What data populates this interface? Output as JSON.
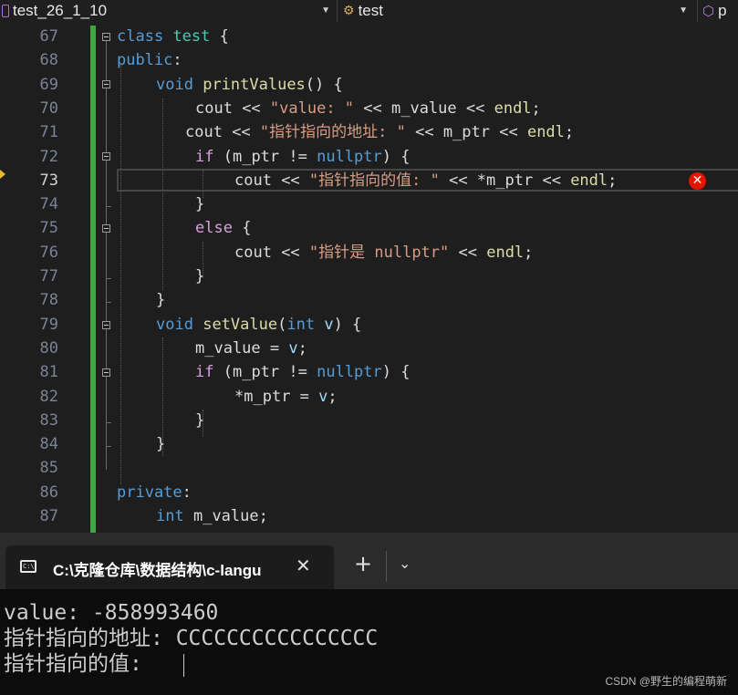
{
  "navbar": {
    "project": "test_26_1_10",
    "scope": "test",
    "member": "p"
  },
  "editor": {
    "line_numbers": [
      "67",
      "68",
      "69",
      "70",
      "71",
      "72",
      "73",
      "74",
      "75",
      "76",
      "77",
      "78",
      "79",
      "80",
      "81",
      "82",
      "83",
      "84",
      "85",
      "86",
      "87"
    ],
    "current_line": "73",
    "code": {
      "l67": {
        "a": "class",
        "b": "test",
        "c": " {"
      },
      "l68": {
        "a": "public",
        "b": ":"
      },
      "l69": {
        "a": "void",
        "b": "printValues",
        "c": "() {"
      },
      "l70": {
        "a": "cout",
        "b": " << ",
        "c": "\"value: \"",
        "d": " << ",
        "e": "m_value",
        "f": " << ",
        "g": "endl",
        "h": ";"
      },
      "l71": {
        "a": "cout",
        "b": " << ",
        "c": "\"指针指向的地址: \"",
        "d": " << ",
        "e": "m_ptr",
        "f": " << ",
        "g": "endl",
        "h": ";"
      },
      "l72": {
        "a": "if",
        "b": " (",
        "c": "m_ptr",
        "d": " != ",
        "e": "nullptr",
        "f": ") {"
      },
      "l73": {
        "a": "cout",
        "b": " << ",
        "c": "\"指针指向的值: \"",
        "d": " << *",
        "e": "m_ptr",
        "f": " << ",
        "g": "endl",
        "h": ";"
      },
      "l74": {
        "a": "}"
      },
      "l75": {
        "a": "else",
        "b": " {"
      },
      "l76": {
        "a": "cout",
        "b": " << ",
        "c": "\"指针是 nullptr\"",
        "d": " << ",
        "e": "endl",
        "f": ";"
      },
      "l77": {
        "a": "}"
      },
      "l78": {
        "a": "}"
      },
      "l79": {
        "a": "void",
        "b": "setValue",
        "c": "(",
        "d": "int",
        "e": " ",
        "f": "v",
        "g": ") {"
      },
      "l80": {
        "a": "m_value",
        "b": " = ",
        "c": "v",
        "d": ";"
      },
      "l81": {
        "a": "if",
        "b": " (",
        "c": "m_ptr",
        "d": " != ",
        "e": "nullptr",
        "f": ") {"
      },
      "l82": {
        "a": "*",
        "b": "m_ptr",
        "c": " = ",
        "d": "v",
        "e": ";"
      },
      "l83": {
        "a": "}"
      },
      "l84": {
        "a": "}"
      },
      "l86": {
        "a": "private",
        "b": ":"
      },
      "l87": {
        "a": "int",
        "b": " ",
        "c": "m_value",
        "d": ";"
      }
    },
    "error_marker": "✕"
  },
  "terminal": {
    "tab_title": "C:\\克隆仓库\\数据结构\\c-langu",
    "tab_icon": "C:\\",
    "close_glyph": "✕",
    "new_glyph": "+",
    "dropdown_glyph": "⌄",
    "lines": [
      "value: -858993460",
      "指针指向的地址: CCCCCCCCCCCCCCCC",
      "指针指向的值: "
    ],
    "watermark": "CSDN @野生的编程萌新"
  },
  "colors": {
    "keyword": "#569cd6",
    "control": "#d8a0df",
    "type": "#4ec9b0",
    "function": "#dcdcaa",
    "string": "#d69d85",
    "change_bar": "#3fa73f",
    "error": "#e51400"
  }
}
